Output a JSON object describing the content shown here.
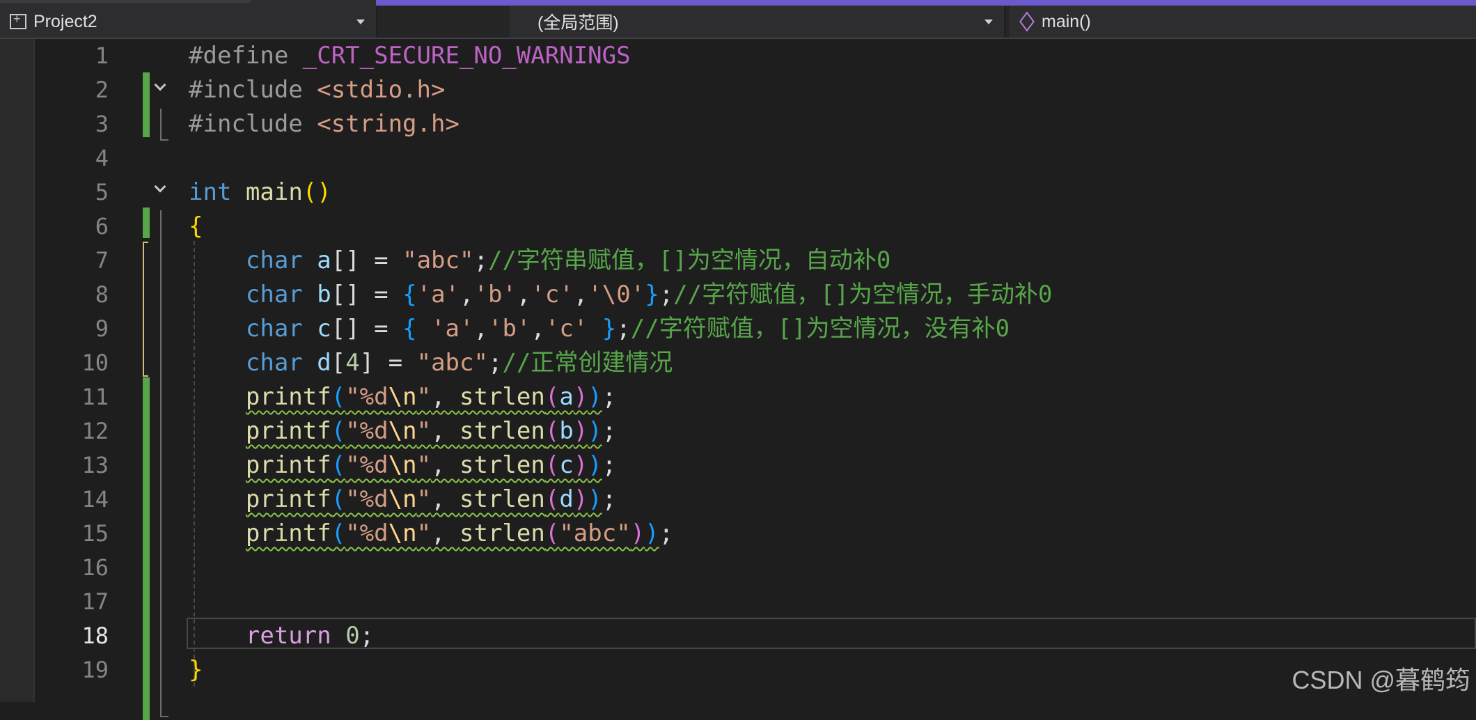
{
  "nav": {
    "project": "Project2",
    "scope": "(全局范围)",
    "member": "main()"
  },
  "lines": [
    {
      "n": "1",
      "code": [
        "#define ",
        "_CRT_SECURE_NO_WARNINGS"
      ]
    },
    {
      "n": "2",
      "code": [
        "#include ",
        "<stdio.h>"
      ]
    },
    {
      "n": "3",
      "code": [
        "#include ",
        "<string.h>"
      ]
    },
    {
      "n": "4",
      "code": []
    },
    {
      "n": "5",
      "code": [
        "int",
        " ",
        "main",
        "()"
      ]
    },
    {
      "n": "6",
      "code": [
        "{"
      ]
    },
    {
      "n": "7",
      "code": [
        "char",
        " ",
        "a",
        "[] = ",
        "\"abc\"",
        ";",
        "//字符串赋值，[]为空情况，自动补0"
      ]
    },
    {
      "n": "8",
      "code": [
        "char",
        " ",
        "b",
        "[] = ",
        "{",
        "'a'",
        ",",
        "'b'",
        ",",
        "'c'",
        ",",
        "'\\0'",
        "}",
        ";",
        "//字符赋值，[]为空情况，手动补0"
      ]
    },
    {
      "n": "9",
      "code": [
        "char",
        " ",
        "c",
        "[] = ",
        "{",
        " ",
        "'a'",
        ",",
        "'b'",
        ",",
        "'c'",
        " ",
        "}",
        ";",
        "//字符赋值，[]为空情况，没有补0"
      ]
    },
    {
      "n": "10",
      "code": [
        "char",
        " ",
        "d",
        "[",
        "4",
        "] = ",
        "\"abc\"",
        ";",
        "//正常创建情况"
      ]
    },
    {
      "n": "11",
      "code": [
        "printf",
        "(",
        "\"%d",
        "\\n",
        "\"",
        ", ",
        "strlen",
        "(",
        "a",
        ")",
        ")",
        ";"
      ]
    },
    {
      "n": "12",
      "code": [
        "printf",
        "(",
        "\"%d",
        "\\n",
        "\"",
        ", ",
        "strlen",
        "(",
        "b",
        ")",
        ")",
        ";"
      ]
    },
    {
      "n": "13",
      "code": [
        "printf",
        "(",
        "\"%d",
        "\\n",
        "\"",
        ", ",
        "strlen",
        "(",
        "c",
        ")",
        ")",
        ";"
      ]
    },
    {
      "n": "14",
      "code": [
        "printf",
        "(",
        "\"%d",
        "\\n",
        "\"",
        ", ",
        "strlen",
        "(",
        "d",
        ")",
        ")",
        ";"
      ]
    },
    {
      "n": "15",
      "code": [
        "printf",
        "(",
        "\"%d",
        "\\n",
        "\"",
        ", ",
        "strlen",
        "(",
        "\"abc\"",
        ")",
        ")",
        ";"
      ]
    },
    {
      "n": "16",
      "code": []
    },
    {
      "n": "17",
      "code": []
    },
    {
      "n": "18",
      "code": [
        "return",
        " ",
        "0",
        ";"
      ]
    },
    {
      "n": "19",
      "code": [
        "}"
      ]
    }
  ],
  "current_line": "18",
  "watermark": "CSDN @暮鹤筠"
}
